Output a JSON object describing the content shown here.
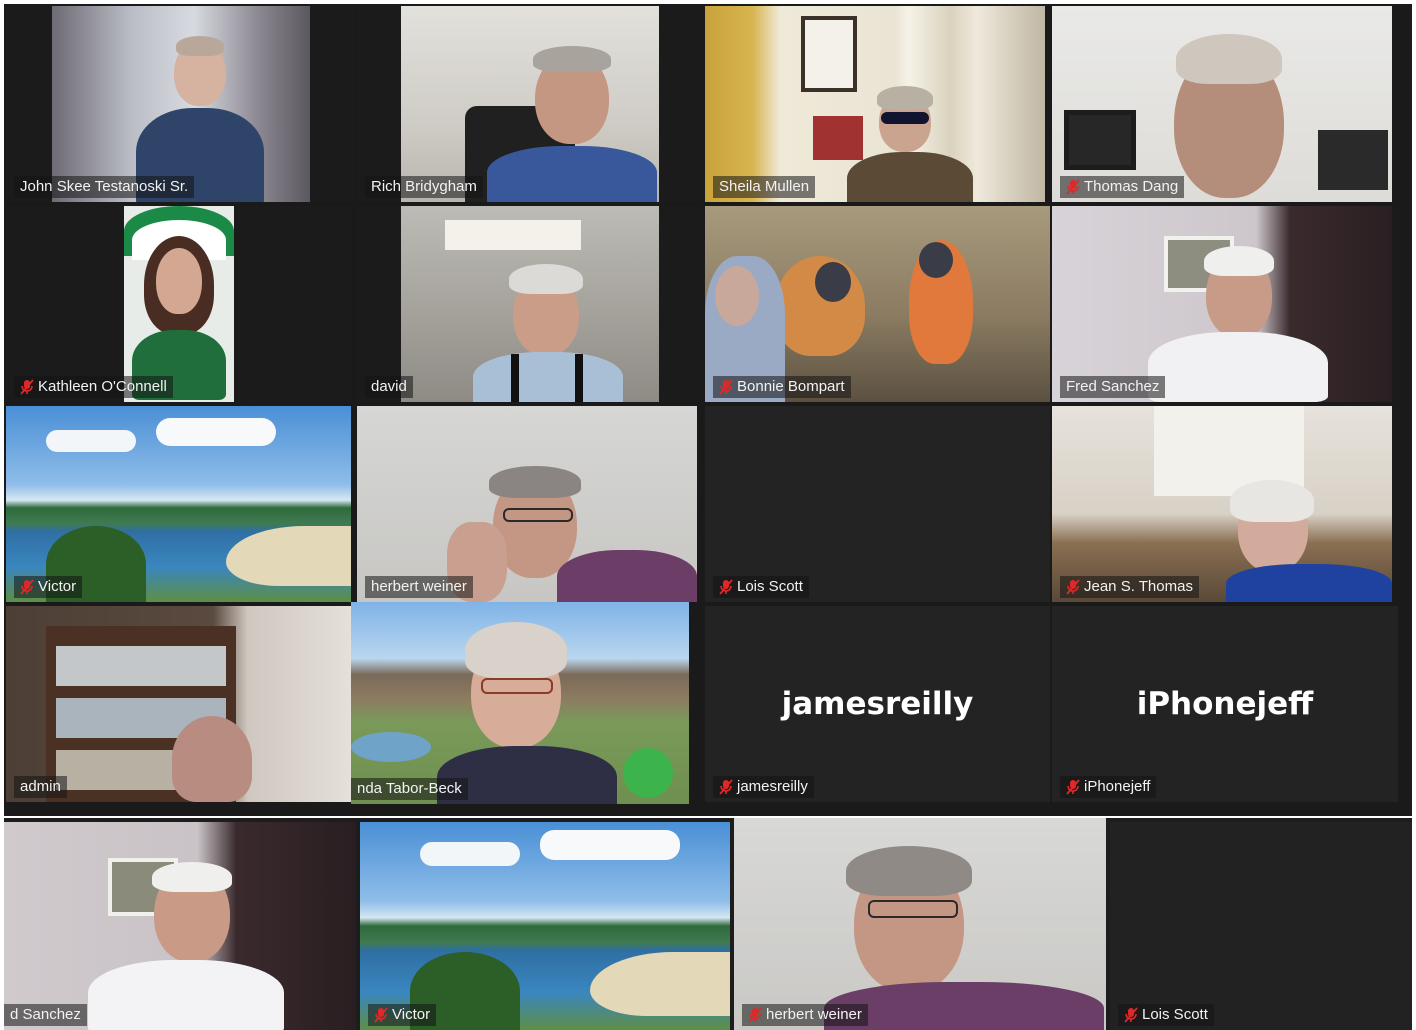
{
  "meeting": {
    "colors": {
      "background": "#1a1a1a",
      "tile": "#232323",
      "active_speaker_border": "#d8e37a",
      "muted_icon": "#e02828"
    },
    "gallery": [
      {
        "id": "john",
        "name": "John Skee Testanoski  Sr.",
        "muted": false,
        "active": true
      },
      {
        "id": "rich",
        "name": "Rich Bridygham",
        "muted": false
      },
      {
        "id": "sheila",
        "name": "Sheila Mullen",
        "muted": false
      },
      {
        "id": "thomas",
        "name": "Thomas Dang",
        "muted": true
      },
      {
        "id": "kathleen",
        "name": "Kathleen O'Connell",
        "muted": true
      },
      {
        "id": "david",
        "name": "david",
        "muted": false
      },
      {
        "id": "bonnie",
        "name": "Bonnie Bompart",
        "muted": true
      },
      {
        "id": "fred",
        "name": "Fred Sanchez",
        "muted": false
      },
      {
        "id": "victor",
        "name": "Victor",
        "muted": true
      },
      {
        "id": "herbert",
        "name": "herbert weiner",
        "muted": false
      },
      {
        "id": "lois",
        "name": "Lois Scott",
        "muted": true
      },
      {
        "id": "jean",
        "name": "Jean S. Thomas",
        "muted": true
      },
      {
        "id": "admin",
        "name": "admin",
        "muted": false
      },
      {
        "id": "linda",
        "name": "nda Tabor-Beck",
        "muted": false
      },
      {
        "id": "james",
        "name": "jamesreilly",
        "muted": true,
        "display_name": "jamesreilly"
      },
      {
        "id": "iphone",
        "name": "iPhonejeff",
        "muted": true,
        "display_name": "iPhonejeff"
      }
    ],
    "strip": [
      {
        "id": "fred2",
        "name": "d Sanchez",
        "muted": false
      },
      {
        "id": "victor2",
        "name": "Victor",
        "muted": true
      },
      {
        "id": "herbert2",
        "name": "herbert weiner",
        "muted": true
      },
      {
        "id": "lois2",
        "name": "Lois Scott",
        "muted": true
      }
    ]
  }
}
